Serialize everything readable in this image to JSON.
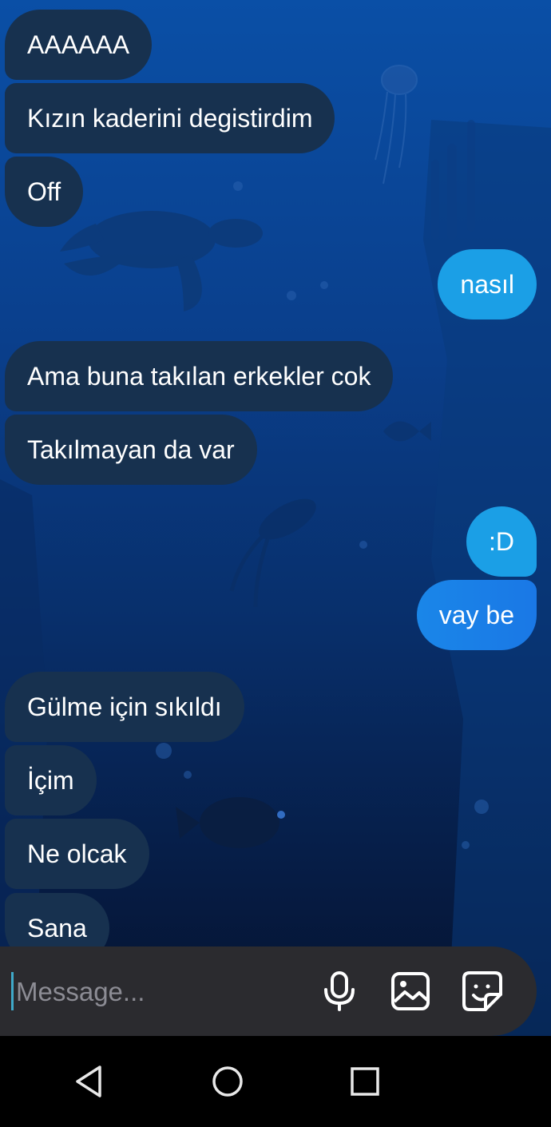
{
  "messages": [
    {
      "text": "AAAAAA",
      "side": "in"
    },
    {
      "text": "Kızın kaderini degistirdim",
      "side": "in"
    },
    {
      "text": "Off",
      "side": "in"
    },
    {
      "text": "nasıl",
      "side": "out"
    },
    {
      "text": "Ama buna takılan erkekler cok",
      "side": "in"
    },
    {
      "text": "Takılmayan da var",
      "side": "in"
    },
    {
      "text": ":D",
      "side": "out"
    },
    {
      "text": "vay be",
      "side": "out"
    },
    {
      "text": "Gülme için sıkıldı",
      "side": "in"
    },
    {
      "text": "İçim",
      "side": "in"
    },
    {
      "text": "Ne olcak",
      "side": "in"
    },
    {
      "text": "Sana",
      "side": "in"
    }
  ],
  "composer": {
    "placeholder": "Message...",
    "mic_icon": "microphone-icon",
    "gallery_icon": "image-gallery-icon",
    "sticker_icon": "sticker-icon"
  },
  "navbar": {
    "back_icon": "back-triangle-icon",
    "home_icon": "home-circle-icon",
    "recents_icon": "recents-square-icon"
  },
  "colors": {
    "incoming_bubble": "#17314f",
    "outgoing_bubble": "#1a80e6",
    "outgoing_bubble_light": "#1b9fe6",
    "composer_bg": "#2b2b2f"
  }
}
